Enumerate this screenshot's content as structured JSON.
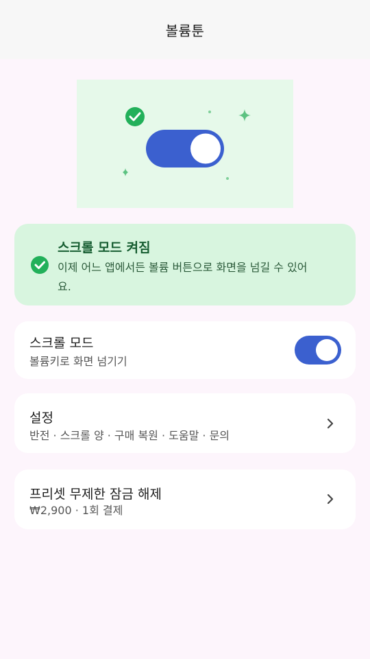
{
  "app_bar": {
    "title": "볼륨툰"
  },
  "hero": {
    "description": "Illustration: toggle switch turned on with a green check mark and sparkles"
  },
  "status_banner": {
    "title": "스크롤 모드 켜짐",
    "message": "이제 어느 앱에서든 볼륨 버튼으로 화면을 넘길 수 있어요.",
    "icon": "check-circle-icon"
  },
  "scroll_mode": {
    "title": "스크롤 모드",
    "subtitle": "볼륨키로 화면 넘기기",
    "enabled": true
  },
  "settings": {
    "title": "설정",
    "subtitle": "반전 · 스크롤 양 · 구매 복원 · 도움말 · 문의",
    "icon": "chevron-right-icon"
  },
  "premium": {
    "title": "프리셋 무제한 잠금 해제",
    "subtitle": "₩2,900 · 1회 결제",
    "icon": "chevron-right-icon"
  },
  "colors": {
    "accent": "#3b60cf",
    "success": "#22b05a",
    "banner_bg": "#d8f5df",
    "page_bg": "#fdf5fc"
  }
}
